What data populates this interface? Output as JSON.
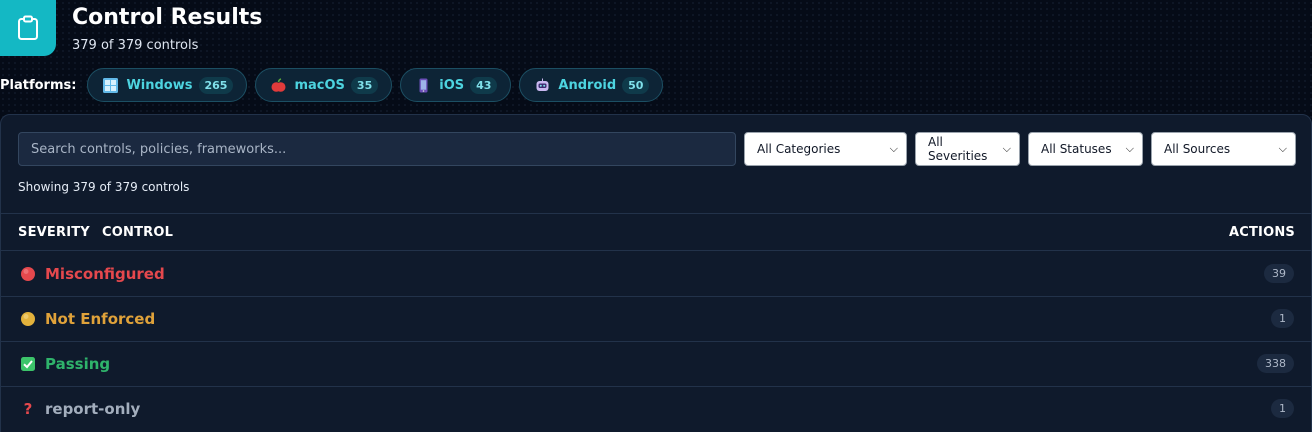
{
  "header": {
    "title": "Control Results",
    "subtitle": "379 of 379 controls",
    "icon": "clipboard-icon",
    "accent": "#14b8c4"
  },
  "platforms": {
    "label": "Platforms:",
    "items": [
      {
        "name": "Windows",
        "count": "265",
        "icon": "windows-icon"
      },
      {
        "name": "macOS",
        "count": "35",
        "icon": "apple-icon"
      },
      {
        "name": "iOS",
        "count": "43",
        "icon": "phone-icon"
      },
      {
        "name": "Android",
        "count": "50",
        "icon": "robot-icon"
      }
    ]
  },
  "filters": {
    "search_placeholder": "Search controls, policies, frameworks...",
    "categories": "All Categories",
    "severities": "All Severities",
    "statuses": "All Statuses",
    "sources": "All Sources"
  },
  "showing_text": "Showing 379 of 379 controls",
  "table": {
    "headers": {
      "severity": "SEVERITY",
      "control": "CONTROL",
      "actions": "ACTIONS"
    },
    "rows": [
      {
        "label": "Misconfigured",
        "count": "39",
        "color": "#e5484d",
        "icon": "red-circle-icon"
      },
      {
        "label": "Not Enforced",
        "count": "1",
        "color": "#e0a23a",
        "icon": "yellow-circle-icon"
      },
      {
        "label": "Passing",
        "count": "338",
        "color": "#2fb36b",
        "icon": "check-box-icon"
      },
      {
        "label": "report-only",
        "count": "1",
        "color": "#a3aebd",
        "icon": "question-mark-icon"
      }
    ]
  }
}
